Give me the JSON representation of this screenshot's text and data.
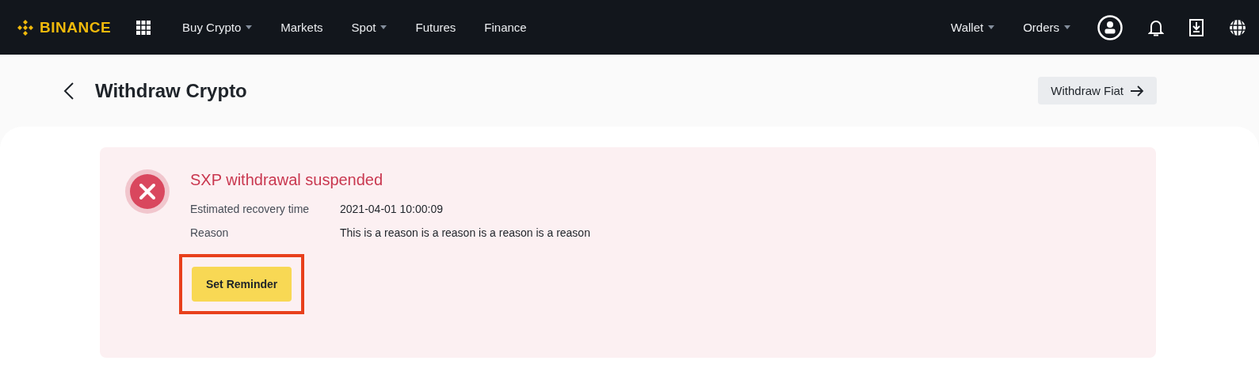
{
  "navbar": {
    "logo": "BINANCE",
    "menu": [
      {
        "label": "Buy Crypto",
        "caret": true
      },
      {
        "label": "Markets",
        "caret": false
      },
      {
        "label": "Spot",
        "caret": true
      },
      {
        "label": "Futures",
        "caret": false
      },
      {
        "label": "Finance",
        "caret": false
      }
    ],
    "right_menu": [
      {
        "label": "Wallet",
        "caret": true
      },
      {
        "label": "Orders",
        "caret": true
      }
    ]
  },
  "header": {
    "title": "Withdraw Crypto",
    "action": "Withdraw Fiat"
  },
  "alert": {
    "title": "SXP withdrawal suspended",
    "rows": [
      {
        "label": "Estimated recovery time",
        "value": "2021-04-01 10:00:09"
      },
      {
        "label": "Reason",
        "value": "This is a reason is a reason is a reason is a reason"
      }
    ],
    "button": {
      "label": "Set Reminder",
      "highlighted": true
    }
  }
}
